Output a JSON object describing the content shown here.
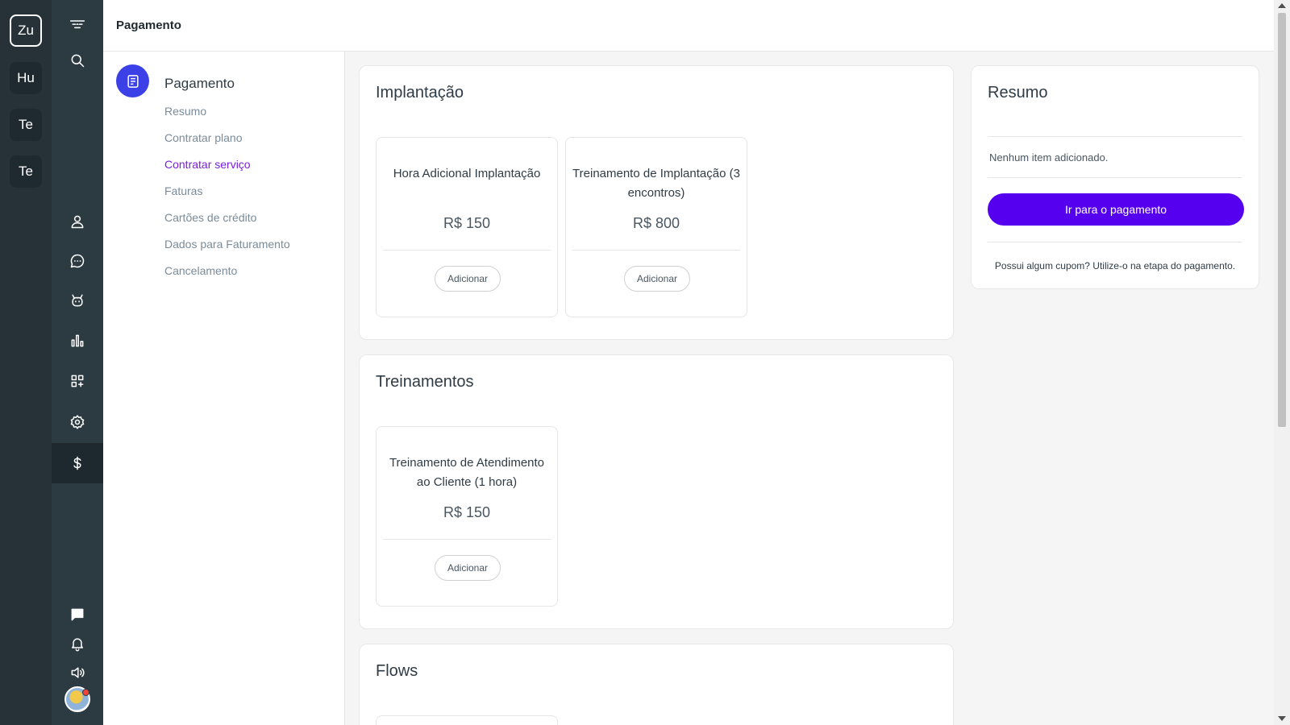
{
  "workspaces": [
    {
      "label": "Zu",
      "active": true
    },
    {
      "label": "Hu",
      "active": false
    },
    {
      "label": "Te",
      "active": false
    },
    {
      "label": "Te",
      "active": false
    }
  ],
  "nav_icons": [
    "logo-icon",
    "search-icon",
    "user-icon",
    "chat-bubble-icon",
    "bot-icon",
    "bar-chart-icon",
    "apps-icon",
    "gear-icon",
    "dollar-icon",
    "message-icon",
    "bell-icon",
    "speaker-icon"
  ],
  "header": {
    "title": "Pagamento"
  },
  "submenu": {
    "title": "Pagamento",
    "items": [
      "Resumo",
      "Contratar plano",
      "Contratar serviço",
      "Faturas",
      "Cartões de crédito",
      "Dados para Faturamento",
      "Cancelamento"
    ],
    "active_item": "Contratar serviço"
  },
  "sections": [
    {
      "title": "Implantação",
      "cards": [
        {
          "name": "Hora Adicional Implantação",
          "price": "R$ 150",
          "button": "Adicionar"
        },
        {
          "name": "Treinamento de Implantação (3 encontros)",
          "price": "R$ 800",
          "button": "Adicionar"
        }
      ]
    },
    {
      "title": "Treinamentos",
      "cards": [
        {
          "name": "Treinamento de Atendimento ao Cliente (1 hora)",
          "price": "R$ 150",
          "button": "Adicionar"
        }
      ]
    },
    {
      "title": "Flows",
      "cards": []
    }
  ],
  "summary": {
    "title": "Resumo",
    "empty_text": "Nenhum item adicionado.",
    "pay_button": "Ir para o pagamento",
    "coupon_note": "Possui algum cupom? Utilize-o na etapa do pagamento."
  },
  "colors": {
    "rail_bg": "#263238",
    "nav_bg": "#2c3a42",
    "accent": "#5500ee",
    "active_link": "#7a1ee0",
    "submenu_icon_bg": "#3b41e6"
  }
}
